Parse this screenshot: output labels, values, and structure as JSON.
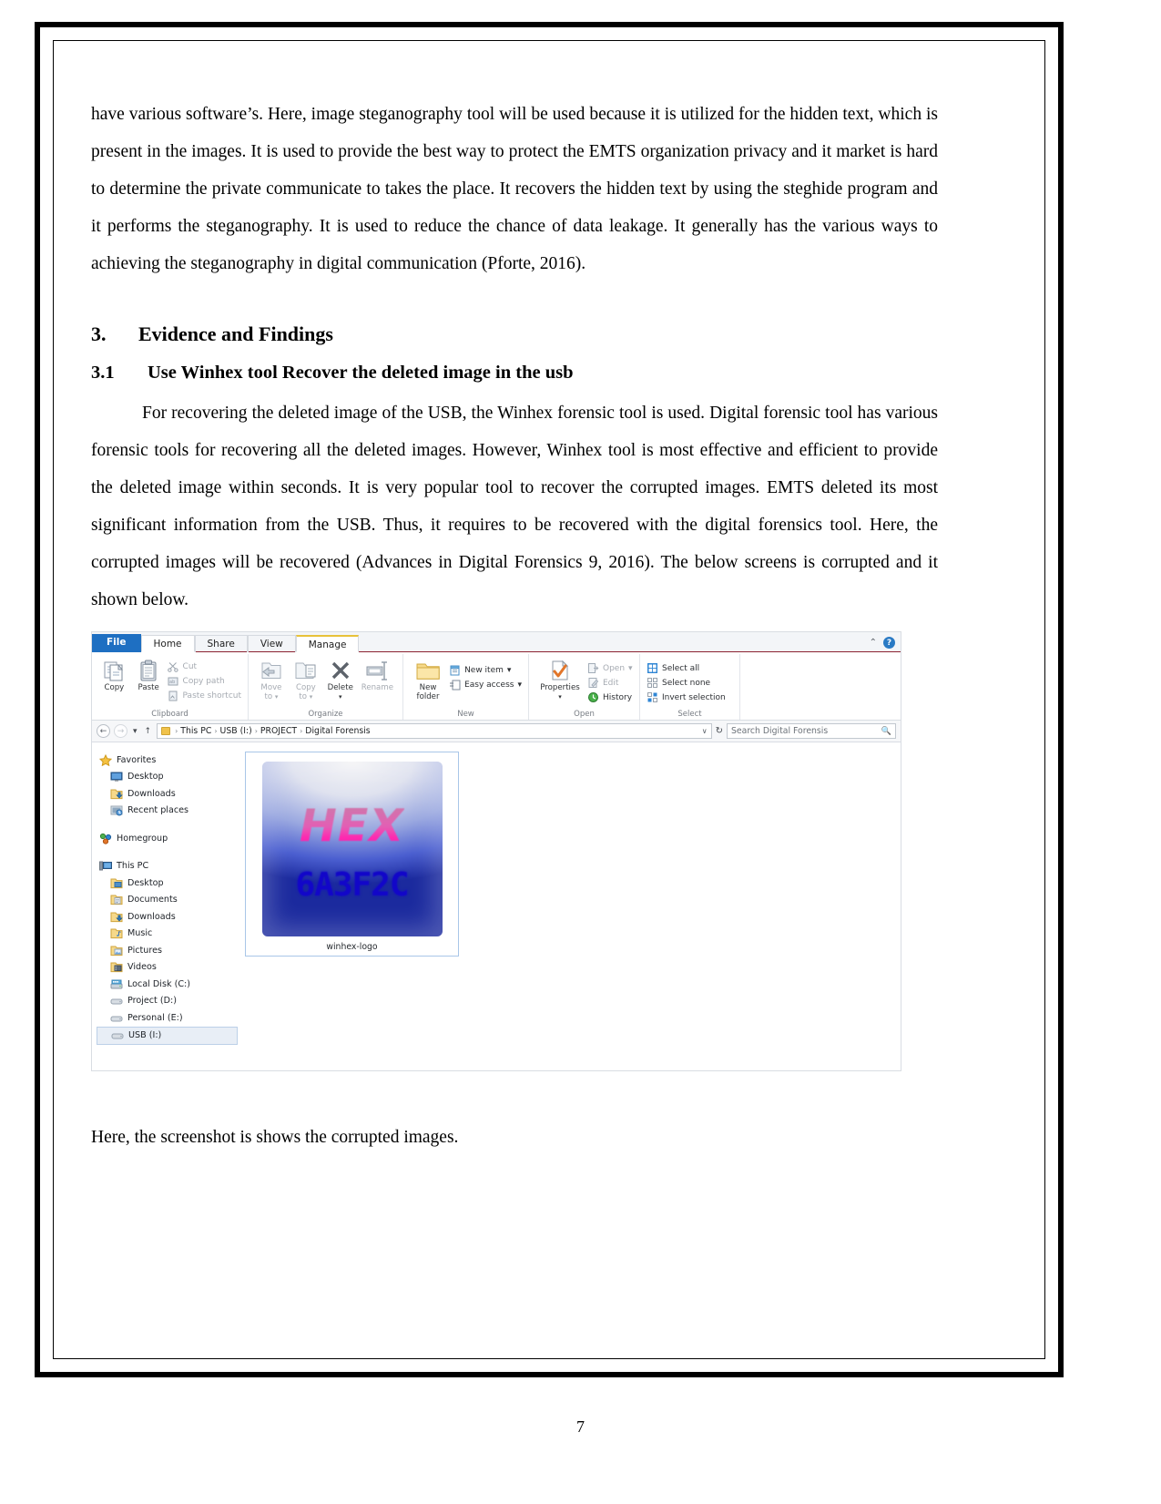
{
  "document": {
    "paragraph_1": "have various software’s. Here, image steganography tool will be used because it is utilized for the hidden text, which is present in the images. It is used to provide the best way to protect the EMTS organization privacy and it market is hard to determine the private communicate to takes the place. It recovers the hidden text by using the steghide program and it performs the steganography. It is used to reduce the chance of data leakage. It generally has the various ways to achieving the steganography in digital communication (Pforte, 2016).",
    "heading_3_number": "3.",
    "heading_3_title": "Evidence and Findings",
    "heading_31_number": "3.1",
    "heading_31_title": "Use Winhex tool Recover the deleted image in the usb",
    "paragraph_2": "For recovering the deleted image of the USB, the Winhex forensic tool is used. Digital forensic tool has various forensic tools for recovering all the deleted images. However, Winhex tool is most effective and efficient to provide the deleted image within seconds. It is very popular tool to recover the corrupted images. EMTS deleted its most significant information from the USB. Thus, it requires to be recovered with the digital forensics tool. Here, the corrupted images will be recovered (Advances in Digital Forensics 9, 2016). The below screens is corrupted and it shown below.",
    "caption_after_figure": "Here, the screenshot is shows the corrupted images.",
    "page_number": "7"
  },
  "explorer": {
    "tabs": [
      {
        "label": "File",
        "kind": "file"
      },
      {
        "label": "Home",
        "kind": "active"
      },
      {
        "label": "Share",
        "kind": "normal"
      },
      {
        "label": "View",
        "kind": "normal"
      },
      {
        "label": "Manage",
        "kind": "manage"
      }
    ],
    "titlebar_right": {
      "collapse_icon": "chevron-up-icon",
      "collapse_glyph": "⌃",
      "help_icon": "help-icon",
      "help_glyph": "?"
    },
    "ribbon": {
      "groups": [
        {
          "label": "Clipboard",
          "big_buttons": [
            {
              "label": "Copy",
              "icon": "copy-icon",
              "dropdown": false,
              "dim": false
            },
            {
              "label": "Paste",
              "icon": "paste-icon",
              "dropdown": false,
              "dim": false
            }
          ],
          "small_buttons": [
            {
              "label": "Cut",
              "icon": "scissors-icon",
              "dim": true
            },
            {
              "label": "Copy path",
              "icon": "copy-path-icon",
              "dim": true
            },
            {
              "label": "Paste shortcut",
              "icon": "paste-shortcut-icon",
              "dim": true
            }
          ]
        },
        {
          "label": "Organize",
          "big_buttons": [
            {
              "label": "Move to",
              "icon": "move-to-icon",
              "dropdown": true,
              "dim": true
            },
            {
              "label": "Copy to",
              "icon": "copy-to-icon",
              "dropdown": true,
              "dim": true
            },
            {
              "label": "Delete",
              "icon": "delete-icon",
              "dropdown": true,
              "dim": false
            },
            {
              "label": "Rename",
              "icon": "rename-icon",
              "dropdown": false,
              "dim": true
            }
          ],
          "small_buttons": []
        },
        {
          "label": "New",
          "big_buttons": [
            {
              "label": "New folder",
              "icon": "new-folder-icon",
              "dropdown": false,
              "dim": false
            }
          ],
          "small_buttons": [
            {
              "label": "New item",
              "icon": "new-item-icon",
              "dim": false,
              "dropdown": true
            },
            {
              "label": "Easy access",
              "icon": "easy-access-icon",
              "dim": false,
              "dropdown": true
            }
          ]
        },
        {
          "label": "Open",
          "big_buttons": [
            {
              "label": "Properties",
              "icon": "properties-icon",
              "dropdown": true,
              "dim": false
            }
          ],
          "small_buttons": [
            {
              "label": "Open",
              "icon": "open-icon",
              "dim": true,
              "dropdown": true
            },
            {
              "label": "Edit",
              "icon": "edit-icon",
              "dim": true
            },
            {
              "label": "History",
              "icon": "history-icon",
              "dim": false
            }
          ]
        },
        {
          "label": "Select",
          "big_buttons": [],
          "small_buttons": [
            {
              "label": "Select all",
              "icon": "select-all-icon",
              "dim": false
            },
            {
              "label": "Select none",
              "icon": "select-none-icon",
              "dim": false
            },
            {
              "label": "Invert selection",
              "icon": "invert-selection-icon",
              "dim": false
            }
          ]
        }
      ]
    },
    "addressbar": {
      "back_glyph": "←",
      "forward_glyph": "→",
      "recent_glyph": "▾",
      "up_glyph": "↑",
      "breadcrumbs": [
        "This PC",
        "USB (I:)",
        "PROJECT",
        "Digital Forensis"
      ],
      "separator": "›",
      "dropdown_glyph": "∨",
      "refresh_glyph": "↻",
      "search_placeholder": "Search Digital Forensis",
      "search_value": "",
      "search_icon": "search-icon"
    },
    "navpane": {
      "sections": [
        {
          "root": {
            "label": "Favorites",
            "icon": "star-icon"
          },
          "children": [
            {
              "label": "Desktop",
              "icon": "desktop-icon"
            },
            {
              "label": "Downloads",
              "icon": "downloads-icon"
            },
            {
              "label": "Recent places",
              "icon": "recent-places-icon"
            }
          ]
        },
        {
          "root": {
            "label": "Homegroup",
            "icon": "homegroup-icon"
          },
          "children": []
        },
        {
          "root": {
            "label": "This PC",
            "icon": "this-pc-icon"
          },
          "children": [
            {
              "label": "Desktop",
              "icon": "desktop-folder-icon"
            },
            {
              "label": "Documents",
              "icon": "documents-icon"
            },
            {
              "label": "Downloads",
              "icon": "downloads-icon"
            },
            {
              "label": "Music",
              "icon": "music-icon"
            },
            {
              "label": "Pictures",
              "icon": "pictures-icon"
            },
            {
              "label": "Videos",
              "icon": "videos-icon"
            },
            {
              "label": "Local Disk (C:)",
              "icon": "local-disk-icon"
            },
            {
              "label": "Project (D:)",
              "icon": "drive-icon"
            },
            {
              "label": "Personal (E:)",
              "icon": "drive-icon"
            },
            {
              "label": "USB (I:)",
              "icon": "drive-icon",
              "selected": true
            }
          ]
        }
      ]
    },
    "files": [
      {
        "name": "winhex-logo",
        "thumbnail_text_top": "HEX",
        "thumbnail_text_bottom": "6A3F2C",
        "selected": true
      }
    ]
  },
  "colors": {
    "file_tab_blue": "#1e6fc2",
    "ribbon_underline": "#8b2231",
    "manage_tab_accent": "#e8c23a",
    "selection_blue": "#a9c6e8",
    "hex_pink": "#ff27b0",
    "hex_code_blue": "#1206c9"
  }
}
